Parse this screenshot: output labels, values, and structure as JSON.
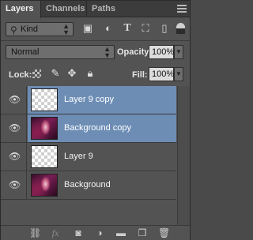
{
  "tabs": [
    {
      "label": "Layers",
      "active": true
    },
    {
      "label": "Channels",
      "active": false
    },
    {
      "label": "Paths",
      "active": false
    }
  ],
  "filter": {
    "kind_label": "Kind",
    "kind_icon": "search-icon",
    "filter_icons": [
      "image-filter-icon",
      "adjustment-filter-icon",
      "type-filter-icon",
      "shape-filter-icon",
      "smart-object-filter-icon"
    ],
    "type_glyph": "T"
  },
  "blend": {
    "mode": "Normal",
    "opacity_label": "Opacity:",
    "opacity_value": "100%"
  },
  "lock": {
    "label": "Lock:",
    "fill_label": "Fill:",
    "fill_value": "100%"
  },
  "layers": [
    {
      "name": "Layer 9 copy",
      "thumbnail": "transparent",
      "selected": true,
      "visible": true
    },
    {
      "name": "Background copy",
      "thumbnail": "photo",
      "selected": true,
      "visible": true
    },
    {
      "name": "Layer 9",
      "thumbnail": "transparent",
      "selected": false,
      "visible": true
    },
    {
      "name": "Background",
      "thumbnail": "photo",
      "selected": false,
      "visible": true
    }
  ],
  "bottom_tools": {
    "fx_label": "fx"
  },
  "colors": {
    "panel_bg": "#535353",
    "selection": "#6d8db5"
  }
}
